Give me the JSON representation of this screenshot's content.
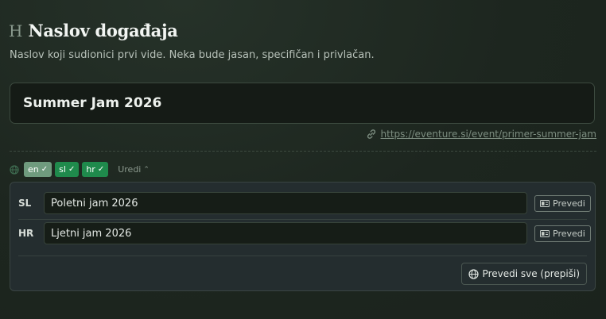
{
  "header": {
    "icon": "heading-icon",
    "icon_glyph": "H",
    "title": "Naslov događaja",
    "subtitle": "Naslov koji sudionici prvi vide. Neka bude jasan, specifičan i privlačan."
  },
  "main_input": {
    "value": "Summer Jam 2026"
  },
  "event_url": {
    "icon": "link-icon",
    "text": "https://eventure.si/event/primer-summer-jam"
  },
  "languages": {
    "icon": "globe-icon",
    "chips": [
      {
        "label": "en",
        "state": "active",
        "check": "✓"
      },
      {
        "label": "sl",
        "state": "done",
        "check": "✓"
      },
      {
        "label": "hr",
        "state": "done",
        "check": "✓"
      }
    ],
    "edit_label": "Uredi",
    "edit_chevron": "⌃"
  },
  "translations": {
    "rows": [
      {
        "code": "SL",
        "value": "Poletni jam 2026",
        "button": "Prevedi"
      },
      {
        "code": "HR",
        "value": "Ljetni jam 2026",
        "button": "Prevedi"
      }
    ],
    "translate_all_label": "Prevedi sve (prepiši)"
  },
  "colors": {
    "background": "#1d261f",
    "chip_done": "#1f8a4c",
    "chip_active": "#6f9b7e",
    "panel": "#242d2f"
  }
}
